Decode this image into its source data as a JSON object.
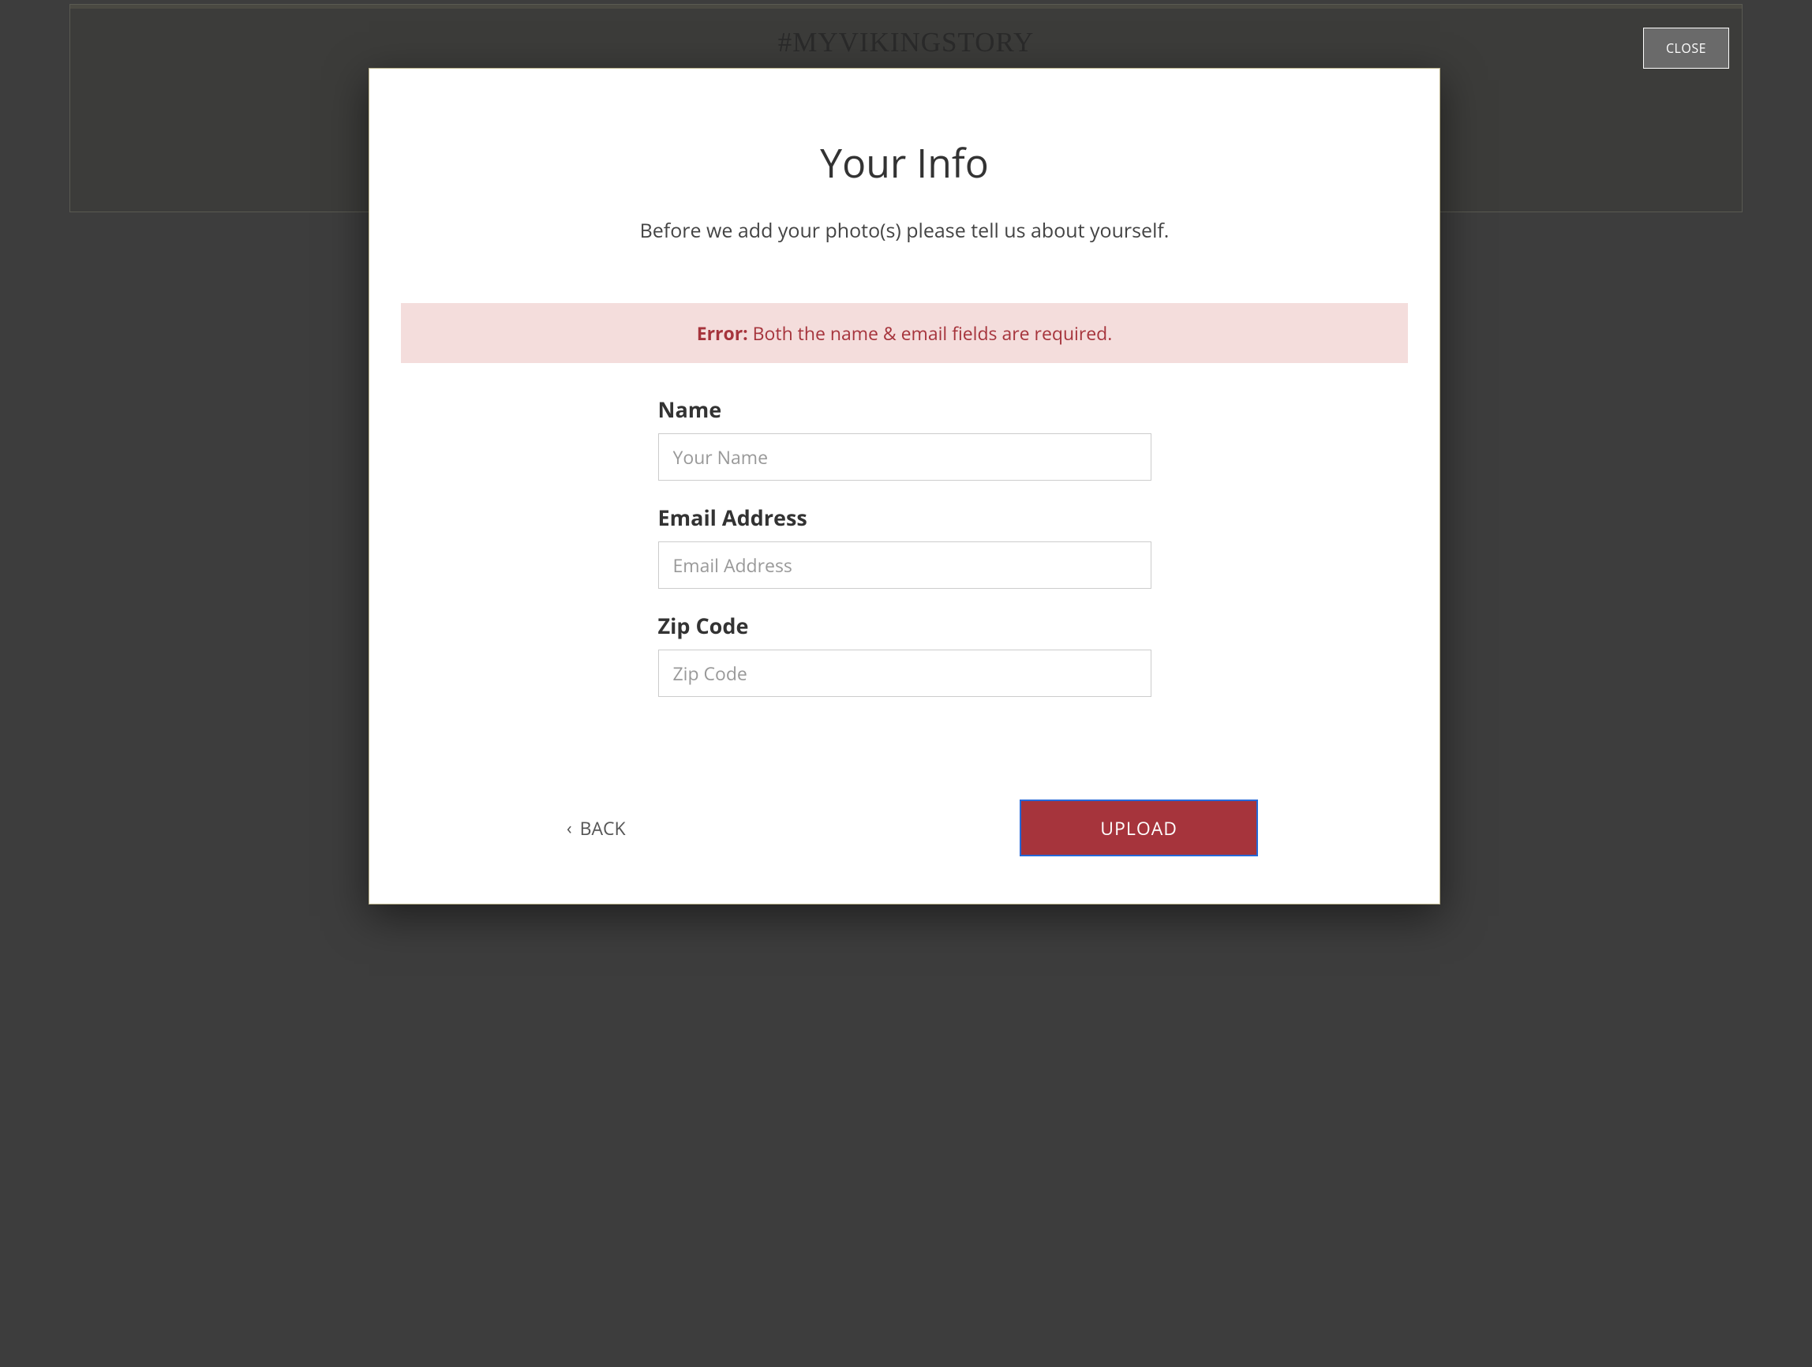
{
  "background": {
    "hashtag": "#MYVIKINGSTORY"
  },
  "modal": {
    "close_label": "CLOSE",
    "title": "Your Info",
    "subtitle": "Before we add your photo(s) please tell us about yourself.",
    "error": {
      "label": "Error:",
      "message": " Both the name & email fields are required."
    },
    "fields": {
      "name": {
        "label": "Name",
        "placeholder": "Your Name",
        "value": ""
      },
      "email": {
        "label": "Email Address",
        "placeholder": "Email Address",
        "value": ""
      },
      "zip": {
        "label": "Zip Code",
        "placeholder": "Zip Code",
        "value": ""
      }
    },
    "footer": {
      "back_label": "BACK",
      "upload_label": "UPLOAD"
    }
  }
}
